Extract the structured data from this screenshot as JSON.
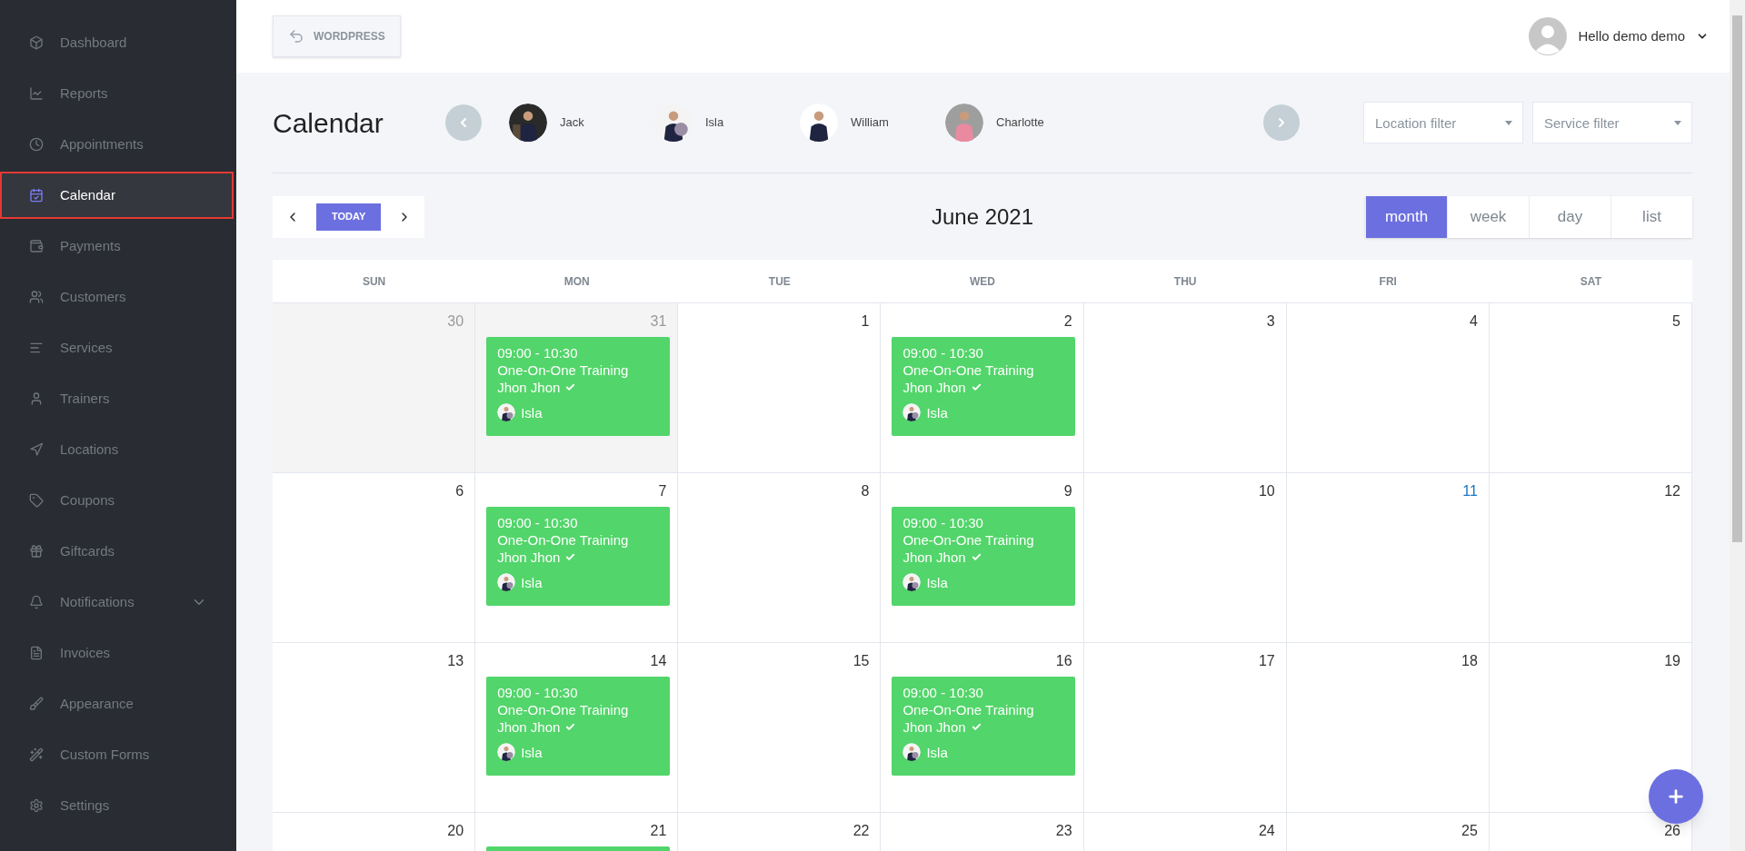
{
  "sidebar": {
    "items": [
      {
        "label": "Dashboard",
        "selected": false
      },
      {
        "label": "Reports",
        "selected": false
      },
      {
        "label": "Appointments",
        "selected": false
      },
      {
        "label": "Calendar",
        "selected": true
      },
      {
        "label": "Payments",
        "selected": false
      },
      {
        "label": "Customers",
        "selected": false
      },
      {
        "label": "Services",
        "selected": false
      },
      {
        "label": "Trainers",
        "selected": false
      },
      {
        "label": "Locations",
        "selected": false
      },
      {
        "label": "Coupons",
        "selected": false
      },
      {
        "label": "Giftcards",
        "selected": false
      },
      {
        "label": "Notifications",
        "selected": false,
        "has_submenu": true
      },
      {
        "label": "Invoices",
        "selected": false
      },
      {
        "label": "Appearance",
        "selected": false
      },
      {
        "label": "Custom Forms",
        "selected": false
      },
      {
        "label": "Settings",
        "selected": false
      }
    ]
  },
  "header": {
    "back_button": "WORDPRESS",
    "user": "Hello demo demo"
  },
  "page_title": "Calendar",
  "trainers": [
    {
      "name": "Jack"
    },
    {
      "name": "Isla"
    },
    {
      "name": "William"
    },
    {
      "name": "Charlotte"
    }
  ],
  "filters": [
    {
      "placeholder": "Location filter"
    },
    {
      "placeholder": "Service filter"
    }
  ],
  "toolbar": {
    "today": "TODAY",
    "title": "June 2021",
    "views": [
      {
        "label": "month",
        "selected": true
      },
      {
        "label": "week",
        "selected": false
      },
      {
        "label": "day",
        "selected": false
      },
      {
        "label": "list",
        "selected": false
      }
    ]
  },
  "weekdays": [
    "SUN",
    "MON",
    "TUE",
    "WED",
    "THU",
    "FRI",
    "SAT"
  ],
  "weeks": [
    {
      "days": [
        {
          "number": "30",
          "muted": true,
          "today": false
        },
        {
          "number": "31",
          "muted": true,
          "today": false,
          "events": [
            {
              "kind": "booking",
              "time": "09:00 - 10:30",
              "service": "One-On-One Training",
              "customer": "Jhon Jhon",
              "confirmed": true,
              "trainer": "Isla"
            }
          ]
        },
        {
          "number": "1",
          "muted": false,
          "today": false
        },
        {
          "number": "2",
          "muted": false,
          "today": false,
          "events": [
            {
              "kind": "booking",
              "time": "09:00 - 10:30",
              "service": "One-On-One Training",
              "customer": "Jhon Jhon",
              "confirmed": true,
              "trainer": "Isla"
            }
          ]
        },
        {
          "number": "3",
          "muted": false,
          "today": false
        },
        {
          "number": "4",
          "muted": false,
          "today": false
        },
        {
          "number": "5",
          "muted": false,
          "today": false
        }
      ]
    },
    {
      "days": [
        {
          "number": "6",
          "muted": false,
          "today": false
        },
        {
          "number": "7",
          "muted": false,
          "today": false,
          "events": [
            {
              "kind": "booking",
              "time": "09:00 - 10:30",
              "service": "One-On-One Training",
              "customer": "Jhon Jhon",
              "confirmed": true,
              "trainer": "Isla"
            }
          ]
        },
        {
          "number": "8",
          "muted": false,
          "today": false
        },
        {
          "number": "9",
          "muted": false,
          "today": false,
          "events": [
            {
              "kind": "booking",
              "time": "09:00 - 10:30",
              "service": "One-On-One Training",
              "customer": "Jhon Jhon",
              "confirmed": true,
              "trainer": "Isla"
            }
          ]
        },
        {
          "number": "10",
          "muted": false,
          "today": false
        },
        {
          "number": "11",
          "muted": false,
          "today": true
        },
        {
          "number": "12",
          "muted": false,
          "today": false
        }
      ]
    },
    {
      "days": [
        {
          "number": "13",
          "muted": false,
          "today": false
        },
        {
          "number": "14",
          "muted": false,
          "today": false,
          "events": [
            {
              "kind": "booking",
              "time": "09:00 - 10:30",
              "service": "One-On-One Training",
              "customer": "Jhon Jhon",
              "confirmed": true,
              "trainer": "Isla"
            }
          ]
        },
        {
          "number": "15",
          "muted": false,
          "today": false
        },
        {
          "number": "16",
          "muted": false,
          "today": false,
          "events": [
            {
              "kind": "booking",
              "time": "09:00 - 10:30",
              "service": "One-On-One Training",
              "customer": "Jhon Jhon",
              "confirmed": true,
              "trainer": "Isla"
            }
          ]
        },
        {
          "number": "17",
          "muted": false,
          "today": false
        },
        {
          "number": "18",
          "muted": false,
          "today": false
        },
        {
          "number": "19",
          "muted": false,
          "today": false
        }
      ]
    },
    {
      "days": [
        {
          "number": "20",
          "muted": false,
          "today": false
        },
        {
          "number": "21",
          "muted": false,
          "today": false,
          "events": [
            {
              "kind": "booking"
            }
          ]
        },
        {
          "number": "22",
          "muted": false,
          "today": false
        },
        {
          "number": "23",
          "muted": false,
          "today": false
        },
        {
          "number": "24",
          "muted": false,
          "today": false
        },
        {
          "number": "25",
          "muted": false,
          "today": false
        },
        {
          "number": "26",
          "muted": false,
          "today": false
        }
      ]
    }
  ]
}
